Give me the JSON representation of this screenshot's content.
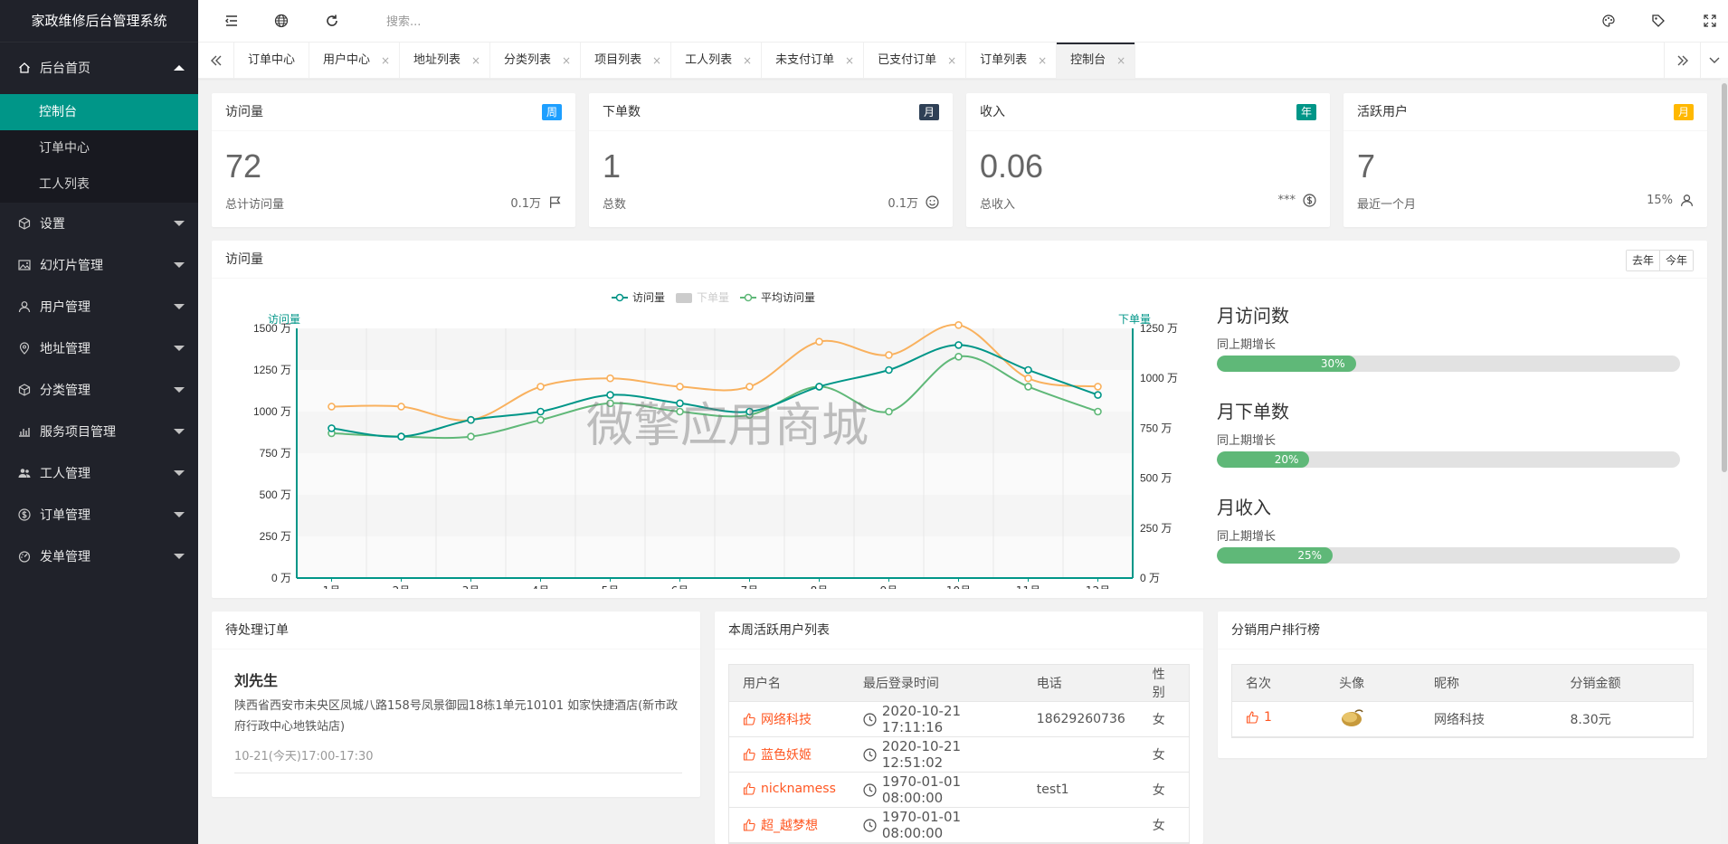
{
  "app": {
    "title": "家政维修后台管理系统"
  },
  "sidebar": {
    "groups": [
      {
        "label": "后台首页",
        "icon": "home-icon",
        "expanded": true,
        "items": [
          {
            "label": "控制台",
            "active": true
          },
          {
            "label": "订单中心",
            "active": false
          },
          {
            "label": "工人列表",
            "active": false
          }
        ]
      },
      {
        "label": "设置",
        "icon": "cube-icon"
      },
      {
        "label": "幻灯片管理",
        "icon": "image-icon"
      },
      {
        "label": "用户管理",
        "icon": "user-icon"
      },
      {
        "label": "地址管理",
        "icon": "location-icon"
      },
      {
        "label": "分类管理",
        "icon": "cube-icon"
      },
      {
        "label": "服务项目管理",
        "icon": "chart-icon"
      },
      {
        "label": "工人管理",
        "icon": "group-icon"
      },
      {
        "label": "订单管理",
        "icon": "dollar-icon"
      },
      {
        "label": "发单管理",
        "icon": "dashboard-icon"
      }
    ]
  },
  "header": {
    "search_placeholder": "搜索..."
  },
  "tabs": {
    "items": [
      {
        "label": "订单中心",
        "closable": false
      },
      {
        "label": "用户中心",
        "closable": true
      },
      {
        "label": "地址列表",
        "closable": true
      },
      {
        "label": "分类列表",
        "closable": true
      },
      {
        "label": "项目列表",
        "closable": true
      },
      {
        "label": "工人列表",
        "closable": true
      },
      {
        "label": "未支付订单",
        "closable": true
      },
      {
        "label": "已支付订单",
        "closable": true
      },
      {
        "label": "订单列表",
        "closable": true
      },
      {
        "label": "控制台",
        "closable": true,
        "active": true
      }
    ],
    "close_glyph": "×"
  },
  "stats": [
    {
      "title": "访问量",
      "badge": "周",
      "badge_color": "#1E9FFF",
      "value": "72",
      "sub": "总计访问量",
      "right": "0.1万",
      "icon": "flag-icon"
    },
    {
      "title": "下单数",
      "badge": "月",
      "badge_color": "#2F4056",
      "value": "1",
      "sub": "总数",
      "right": "0.1万",
      "icon": "smile-icon"
    },
    {
      "title": "收入",
      "badge": "年",
      "badge_color": "#009688",
      "value": "0.06",
      "sub": "总收入",
      "right": "***",
      "icon": "dollar-icon"
    },
    {
      "title": "活跃用户",
      "badge": "月",
      "badge_color": "#FFB800",
      "value": "7",
      "sub": "最近一个月",
      "right": "15%",
      "icon": "user-icon"
    }
  ],
  "visits_panel": {
    "title": "访问量",
    "btn_last_year": "去年",
    "btn_this_year": "今年",
    "watermark": "微擎应用商城"
  },
  "chart_data": {
    "type": "line",
    "categories": [
      "1月",
      "2月",
      "3月",
      "4月",
      "5月",
      "6月",
      "7月",
      "8月",
      "9月",
      "10月",
      "11月",
      "12月"
    ],
    "left_axis": {
      "label": "访问量",
      "ticks": [
        "0 万",
        "250 万",
        "500 万",
        "750 万",
        "1000 万",
        "1250 万",
        "1500 万"
      ],
      "ylim": [
        0,
        1500
      ]
    },
    "right_axis": {
      "label": "下单量",
      "ticks": [
        "0 万",
        "250 万",
        "500 万",
        "750 万",
        "1000 万",
        "1250 万"
      ],
      "ylim": [
        0,
        1250
      ]
    },
    "legend": [
      {
        "name": "访问量",
        "color": "#009688"
      },
      {
        "name": "下单量",
        "color": "#cccccc"
      },
      {
        "name": "平均访问量",
        "color": "#5FB878"
      }
    ],
    "series": [
      {
        "name": "访问量",
        "color": "#009688",
        "axis": "left",
        "values": [
          900,
          850,
          950,
          1000,
          1100,
          1050,
          1000,
          1150,
          1250,
          1400,
          1250,
          1100
        ]
      },
      {
        "name": "平均访问量",
        "color": "#5FB878",
        "axis": "left",
        "values": [
          870,
          850,
          850,
          950,
          1050,
          1000,
          980,
          1150,
          1000,
          1330,
          1150,
          1000
        ]
      },
      {
        "name": "",
        "color": "#F9B15E",
        "axis": "left",
        "values": [
          1030,
          1030,
          950,
          1150,
          1200,
          1150,
          1150,
          1420,
          1340,
          1520,
          1200,
          1150
        ]
      }
    ]
  },
  "progress": [
    {
      "title": "月访问数",
      "label": "同上期增长",
      "percent": 30,
      "text": "30%"
    },
    {
      "title": "月下单数",
      "label": "同上期增长",
      "percent": 20,
      "text": "20%"
    },
    {
      "title": "月收入",
      "label": "同上期增长",
      "percent": 25,
      "text": "25%"
    }
  ],
  "pending_orders": {
    "title": "待处理订单",
    "name": "刘先生",
    "address": "陕西省西安市未央区凤城八路158号凤景御园18栋1单元10101 如家快捷酒店(新市政府行政中心地铁站店)",
    "time": "10-21(今天)17:00-17:30"
  },
  "active_users": {
    "title": "本周活跃用户列表",
    "headers": [
      "用户名",
      "最后登录时间",
      "电话",
      "性别"
    ],
    "rows": [
      [
        "网络科技",
        "2020-10-21 17:11:16",
        "18629260736",
        "女"
      ],
      [
        "蓝色妖姬",
        "2020-10-21 12:51:02",
        "",
        "女"
      ],
      [
        "nicknamess",
        "1970-01-01 08:00:00",
        "test1",
        "女"
      ],
      [
        "超_越梦想",
        "1970-01-01 08:00:00",
        "",
        "女"
      ]
    ]
  },
  "ranking": {
    "title": "分销用户排行榜",
    "headers": [
      "名次",
      "头像",
      "昵称",
      "分销金额"
    ],
    "rows": [
      [
        "1",
        "",
        "网络科技",
        "8.30元"
      ]
    ]
  }
}
